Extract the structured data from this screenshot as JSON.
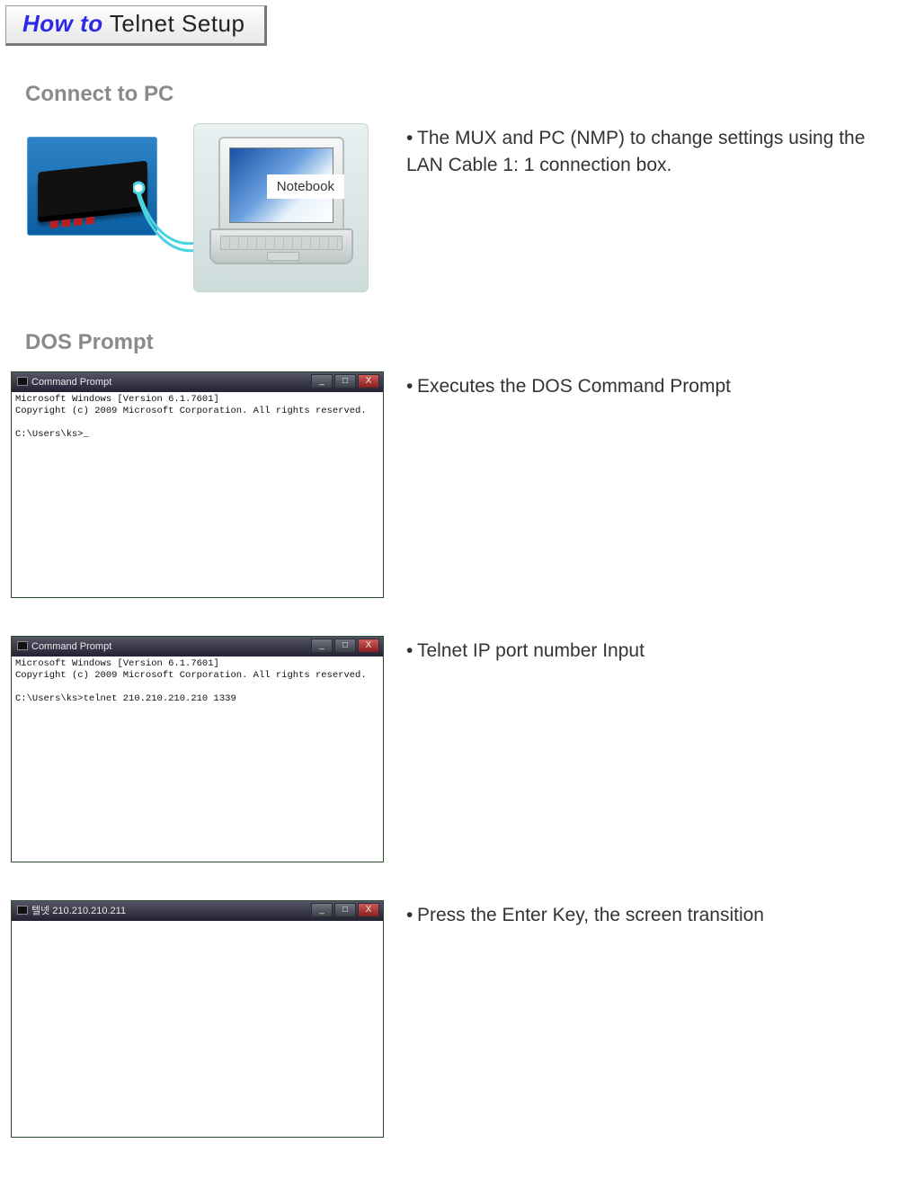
{
  "title": {
    "howto": "How to",
    "rest": " Telnet Setup"
  },
  "section1": {
    "heading": "Connect to PC",
    "notebook_label": "Notebook",
    "bullet": "The MUX and PC (NMP) to change settings using the LAN Cable 1: 1 connection box."
  },
  "section2": {
    "heading": "DOS Prompt"
  },
  "cmd_common": {
    "line1": "Microsoft Windows [Version 6.1.7601]",
    "line2": "Copyright (c) 2009 Microsoft Corporation. All rights reserved."
  },
  "cmd1": {
    "title": "Command Prompt",
    "prompt": "C:\\Users\\ks>_",
    "bullet": "Executes the DOS Command Prompt"
  },
  "cmd2": {
    "title": "Command Prompt",
    "prompt": "C:\\Users\\ks>telnet 210.210.210.210 1339",
    "bullet": "Telnet IP port number Input"
  },
  "cmd3": {
    "title": "텔넷 210.210.210.211",
    "bullet": "Press the Enter Key, the screen transition"
  },
  "win_buttons": {
    "min": "_",
    "max": "□",
    "close": "X"
  }
}
